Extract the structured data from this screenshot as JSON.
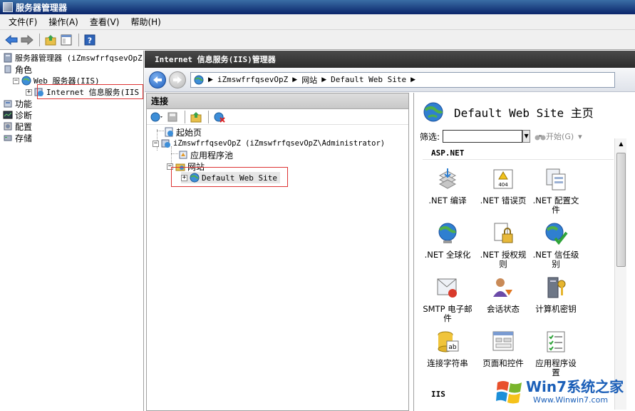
{
  "window": {
    "title": "服务器管理器"
  },
  "menu": [
    "文件(F)",
    "操作(A)",
    "查看(V)",
    "帮助(H)"
  ],
  "left_tree": {
    "root": "服务器管理器 (iZmswfrfqsevOpZ)",
    "roles": "角色",
    "web_server": "Web 服务器(IIS)",
    "iis_manager": "Internet 信息服务(IIS",
    "features": "功能",
    "diagnostics": "诊断",
    "config": "配置",
    "storage": "存储"
  },
  "iis_header": "Internet 信息服务(IIS)管理器",
  "breadcrumb": [
    "iZmswfrfqsevOpZ",
    "网站",
    "Default Web Site"
  ],
  "connections": {
    "title": "连接",
    "start_page": "起始页",
    "server": "iZmswfrfqsevOpZ (iZmswfrfqsevOpZ\\Administrator)",
    "app_pools": "应用程序池",
    "sites": "网站",
    "default_site": "Default Web Site"
  },
  "features_pane": {
    "title": "Default Web Site 主页",
    "filter_label": "筛选:",
    "start_label": "开始(G)",
    "group_aspnet": "ASP.NET",
    "group_iis": "IIS",
    "items": [
      {
        "line1": ".NET 编译",
        "line2": ""
      },
      {
        "line1": ".NET 错误页",
        "line2": ""
      },
      {
        "line1": ".NET 配置文",
        "line2": "件"
      },
      {
        "line1": ".NET 全球化",
        "line2": ""
      },
      {
        "line1": ".NET 授权规",
        "line2": "则"
      },
      {
        "line1": ".NET 信任级",
        "line2": "别"
      },
      {
        "line1": "SMTP 电子邮",
        "line2": "件"
      },
      {
        "line1": "会话状态",
        "line2": ""
      },
      {
        "line1": "计算机密钥",
        "line2": ""
      },
      {
        "line1": "连接字符串",
        "line2": ""
      },
      {
        "line1": "页面和控件",
        "line2": ""
      },
      {
        "line1": "应用程序设",
        "line2": "置"
      }
    ]
  },
  "watermark": {
    "main": "Win7系统之家",
    "sub": "Www.Winwin7.com"
  }
}
